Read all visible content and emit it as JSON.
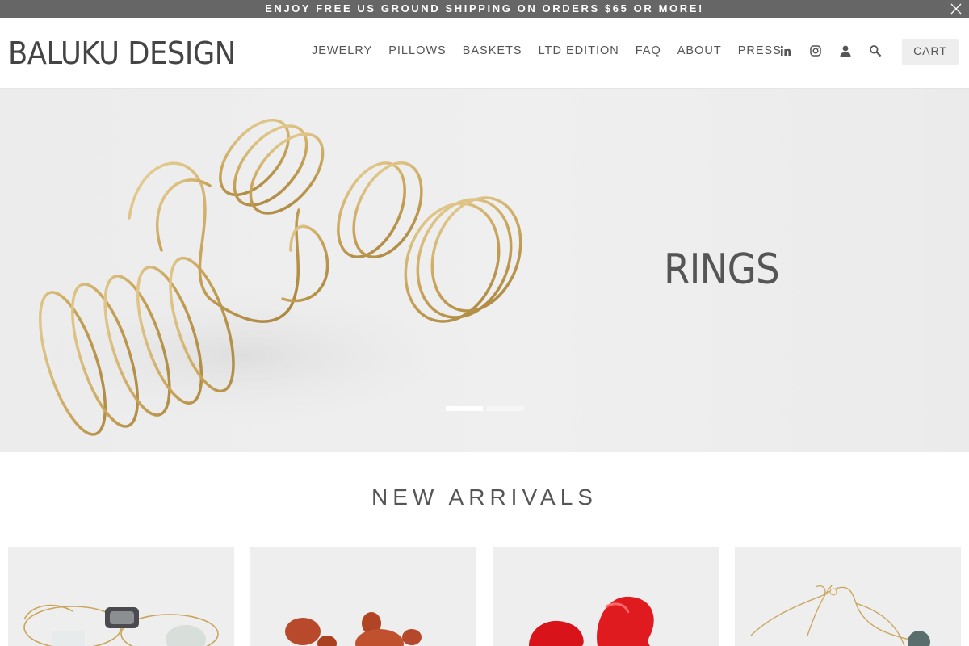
{
  "announcement": {
    "text": "ENJOY FREE US GROUND SHIPPING ON ORDERS $65 OR MORE!",
    "close_icon": "close-icon"
  },
  "header": {
    "logo": "BALUKU DESIGN",
    "nav": [
      {
        "label": "JEWELRY"
      },
      {
        "label": "PILLOWS"
      },
      {
        "label": "BASKETS"
      },
      {
        "label": "LTD EDITION"
      },
      {
        "label": "FAQ"
      },
      {
        "label": "ABOUT"
      },
      {
        "label": "PRESS"
      }
    ],
    "icons": [
      "linkedin-icon",
      "instagram-icon",
      "account-icon",
      "search-icon"
    ],
    "cart_label": "CART"
  },
  "hero": {
    "title": "RINGS",
    "slides_total": 2,
    "active_slide": 1
  },
  "new_arrivals": {
    "title": "NEW ARRIVALS",
    "products": [
      {
        "image": "agate-hoop-earrings"
      },
      {
        "image": "orange-stone-earrings"
      },
      {
        "image": "red-enamel-earrings"
      },
      {
        "image": "gold-wire-drop-earrings"
      }
    ]
  },
  "colors": {
    "announcement_bg": "#666666",
    "text": "#555555",
    "cart_bg": "#eeeeee",
    "hero_bg": "#ececec"
  }
}
